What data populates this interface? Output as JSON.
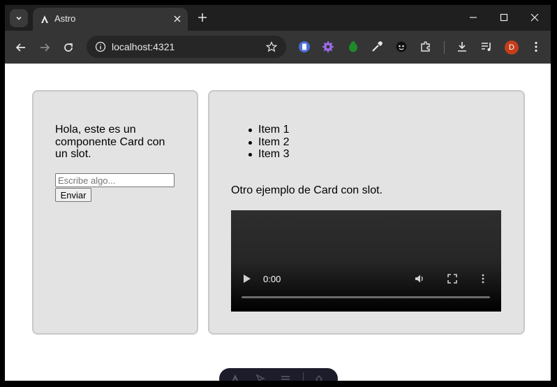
{
  "browser": {
    "tab": {
      "title": "Astro"
    },
    "address": {
      "url": "localhost:4321"
    },
    "profile_initial": "D"
  },
  "page": {
    "card1": {
      "text": "Hola, este es un componente Card con un slot.",
      "input_placeholder": "Escribe algo...",
      "button_label": "Enviar"
    },
    "card2": {
      "items": [
        "Item 1",
        "Item 2",
        "Item 3"
      ],
      "text": "Otro ejemplo de Card con slot.",
      "video": {
        "time": "0:00"
      }
    }
  }
}
